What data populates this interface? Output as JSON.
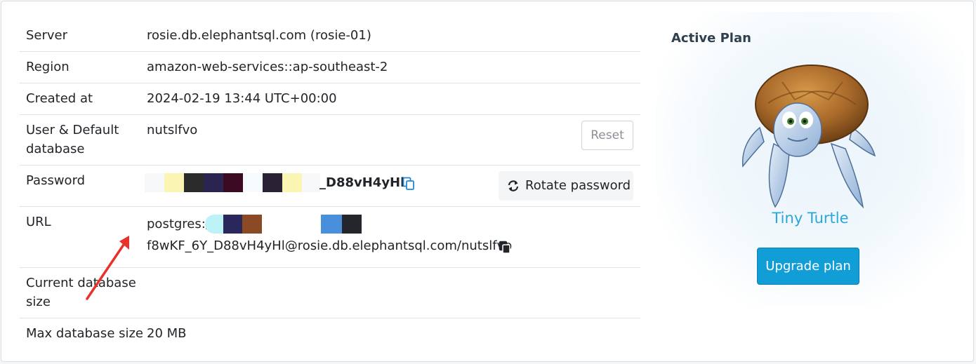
{
  "details": {
    "server": {
      "label": "Server",
      "value": "rosie.db.elephantsql.com (rosie-01)"
    },
    "region": {
      "label": "Region",
      "value": "amazon-web-services::ap-southeast-2"
    },
    "created": {
      "label": "Created at",
      "value": "2024-02-19 13:44 UTC+00:00"
    },
    "user": {
      "label": "User & Default database",
      "value": "nutslfvo",
      "reset_label": "Reset"
    },
    "password": {
      "label": "Password",
      "visible_tail": "D88vH4yHl",
      "rotate_label": "Rotate password"
    },
    "url": {
      "label": "URL",
      "line1_prefix": "postgres:/",
      "line2": "f8wKF_6Y_D88vH4yHl@rosie.db.elephantsql.com/nutslfvo"
    },
    "current_size": {
      "label": "Current database size",
      "value": ""
    },
    "max_size": {
      "label": "Max database size",
      "value": "20 MB"
    }
  },
  "plan": {
    "heading": "Active Plan",
    "name": "Tiny Turtle",
    "upgrade_label": "Upgrade plan"
  },
  "icons": {
    "copy_password": "copy-icon",
    "copy_url": "copy-icon",
    "rotate": "refresh-icon",
    "annotation": "red-arrow-icon"
  },
  "colors": {
    "accent": "#119dd6",
    "plan_name": "#2aa6d8",
    "arrow": "#e8312a"
  }
}
